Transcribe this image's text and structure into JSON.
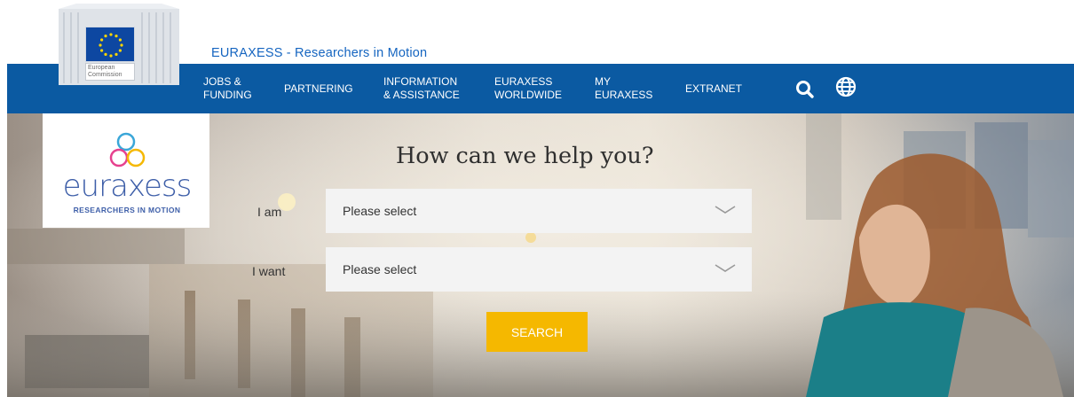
{
  "header": {
    "site_title": "EURAXESS - Researchers in Motion",
    "ec_logo": {
      "caption_line1": "European",
      "caption_line2": "Commission",
      "flag_icon": "eu-flag-icon"
    }
  },
  "nav": {
    "items": [
      {
        "label": "JOBS &\nFUNDING"
      },
      {
        "label": "PARTNERING"
      },
      {
        "label": "INFORMATION\n& ASSISTANCE"
      },
      {
        "label": "EURAXESS\nWORLDWIDE"
      },
      {
        "label": "MY\nEURAXESS"
      },
      {
        "label": "EXTRANET"
      }
    ],
    "search_icon": "search-icon",
    "language_icon": "globe-icon"
  },
  "brand": {
    "wordmark": "euraxess",
    "tagline": "RESEARCHERS IN MOTION"
  },
  "hero": {
    "title": "How can we help you?",
    "iam_label": "I am",
    "iwant_label": "I want",
    "iam_select": {
      "value": "Please select"
    },
    "iwant_select": {
      "value": "Please select"
    },
    "search_label": "SEARCH"
  },
  "colors": {
    "nav_background": "#0b5aa2",
    "search_button": "#f5b800",
    "title_link": "#1565c0",
    "brand_blue": "#3d5ea8"
  }
}
